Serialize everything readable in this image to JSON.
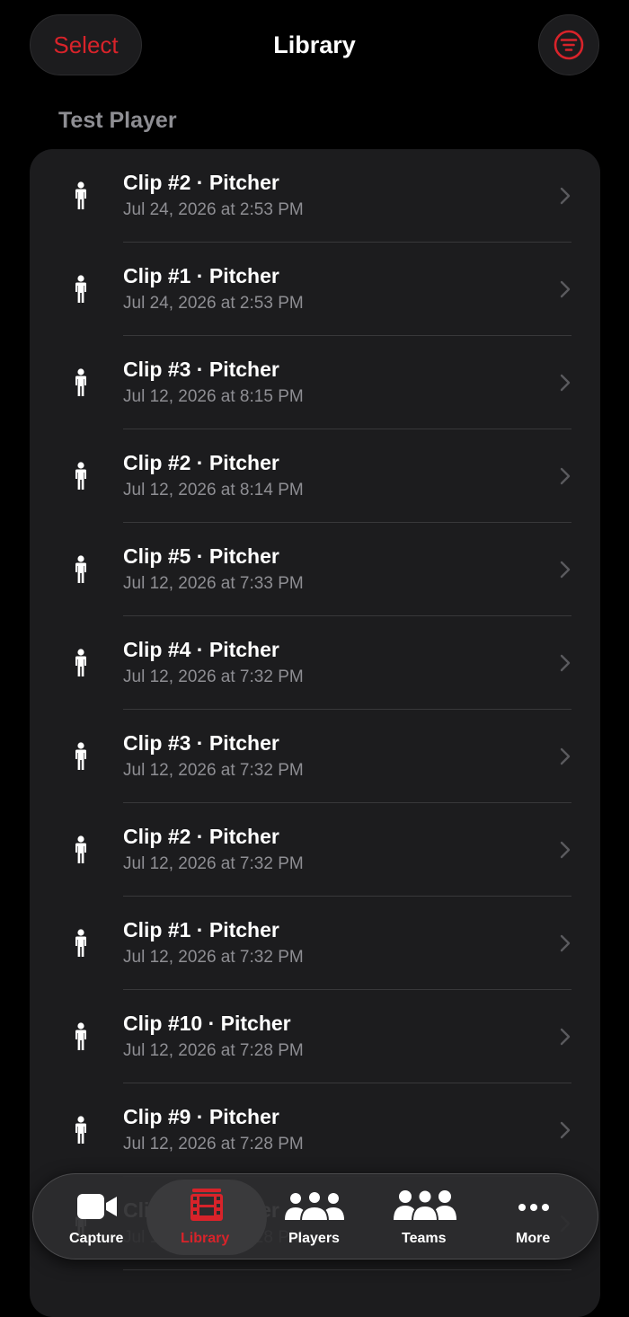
{
  "header": {
    "select_label": "Select",
    "title": "Library",
    "filter_icon": "line-3-horizontal-decrease-circle-icon",
    "accent_color": "#d8232a"
  },
  "section": {
    "title": "Test Player"
  },
  "clips": [
    {
      "title": "Clip #2 · Pitcher",
      "date": "Jul 24, 2026 at 2:53 PM"
    },
    {
      "title": "Clip #1 · Pitcher",
      "date": "Jul 24, 2026 at 2:53 PM"
    },
    {
      "title": "Clip #3 · Pitcher",
      "date": "Jul 12, 2026 at 8:15 PM"
    },
    {
      "title": "Clip #2 · Pitcher",
      "date": "Jul 12, 2026 at 8:14 PM"
    },
    {
      "title": "Clip #5 · Pitcher",
      "date": "Jul 12, 2026 at 7:33 PM"
    },
    {
      "title": "Clip #4 · Pitcher",
      "date": "Jul 12, 2026 at 7:32 PM"
    },
    {
      "title": "Clip #3 · Pitcher",
      "date": "Jul 12, 2026 at 7:32 PM"
    },
    {
      "title": "Clip #2 · Pitcher",
      "date": "Jul 12, 2026 at 7:32 PM"
    },
    {
      "title": "Clip #1 · Pitcher",
      "date": "Jul 12, 2026 at 7:32 PM"
    },
    {
      "title": "Clip #10 · Pitcher",
      "date": "Jul 12, 2026 at 7:28 PM"
    },
    {
      "title": "Clip #9 · Pitcher",
      "date": "Jul 12, 2026 at 7:28 PM"
    },
    {
      "title": "Clip #8 · Pitcher",
      "date": "Jul 12, 2026 at 7:28 PM"
    }
  ],
  "tabs": [
    {
      "label": "Capture",
      "icon": "video-camera-icon",
      "active": false
    },
    {
      "label": "Library",
      "icon": "film-icon",
      "active": true
    },
    {
      "label": "Players",
      "icon": "person-3-icon",
      "active": false
    },
    {
      "label": "Teams",
      "icon": "person-3-fill-icon",
      "active": false
    },
    {
      "label": "More",
      "icon": "ellipsis-icon",
      "active": false
    }
  ]
}
